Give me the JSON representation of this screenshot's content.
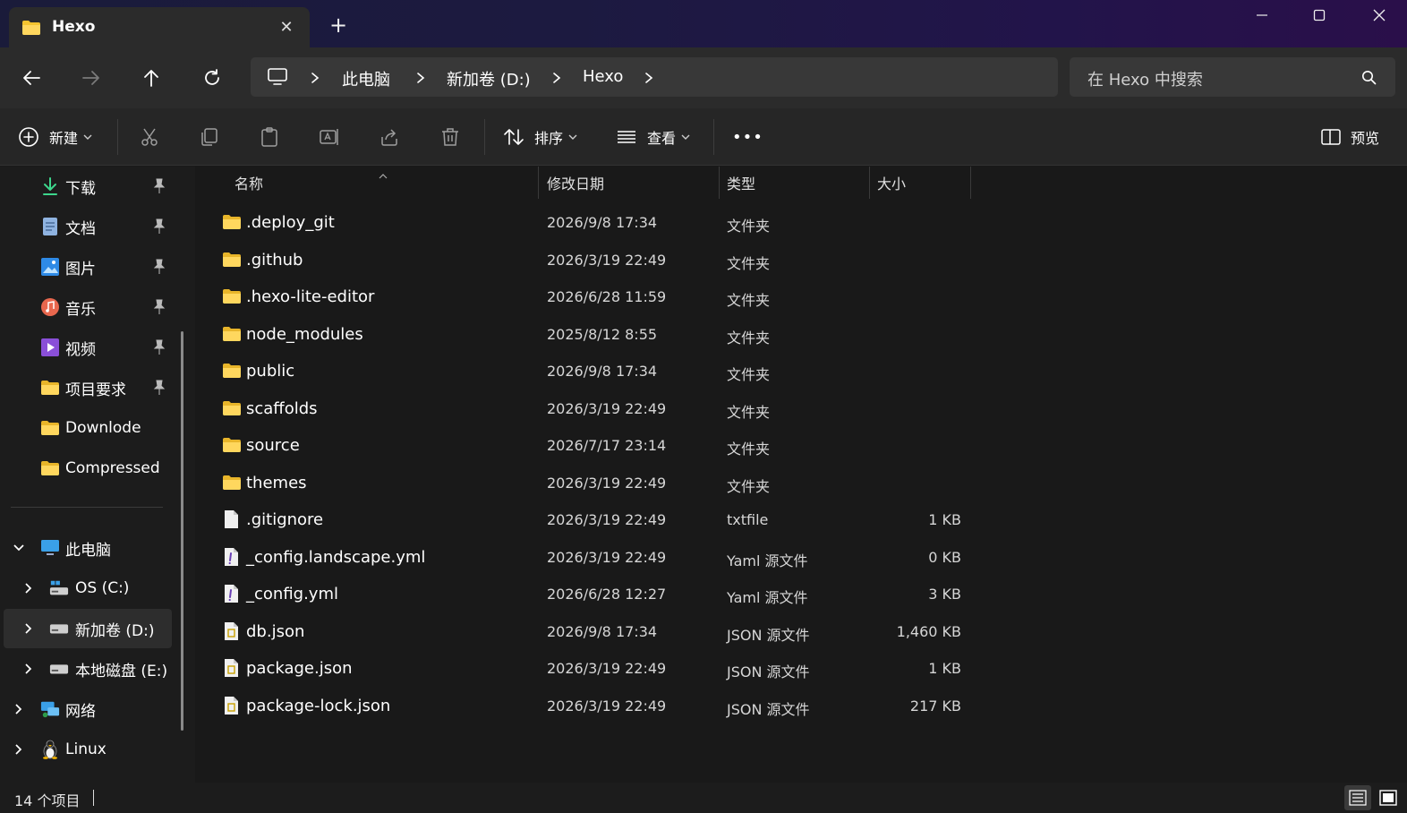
{
  "window": {
    "tab_title": "Hexo",
    "new_tab_symbol": "+",
    "close_tab_symbol": "✕"
  },
  "address": {
    "crumbs": [
      "此电脑",
      "新加卷 (D:)",
      "Hexo"
    ]
  },
  "search": {
    "placeholder": "在 Hexo 中搜索"
  },
  "toolbar": {
    "new_label": "新建",
    "sort_label": "排序",
    "view_label": "查看",
    "more_label": "•••",
    "preview_label": "预览"
  },
  "sidebar": {
    "quick_access": [
      {
        "label": "下载",
        "icon": "download-icon",
        "pinned": true
      },
      {
        "label": "文档",
        "icon": "document-icon",
        "pinned": true
      },
      {
        "label": "图片",
        "icon": "pictures-icon",
        "pinned": true
      },
      {
        "label": "音乐",
        "icon": "music-icon",
        "pinned": true
      },
      {
        "label": "视频",
        "icon": "videos-icon",
        "pinned": true
      },
      {
        "label": "项目要求",
        "icon": "folder-icon",
        "pinned": true
      },
      {
        "label": "Downlode",
        "icon": "folder-icon",
        "pinned": false
      },
      {
        "label": "Compressed",
        "icon": "folder-icon",
        "pinned": false
      }
    ],
    "this_pc": "此电脑",
    "drives": [
      {
        "label": "OS (C:)",
        "icon": "system-drive-icon"
      },
      {
        "label": "新加卷 (D:)",
        "icon": "drive-icon",
        "selected": true
      },
      {
        "label": "本地磁盘 (E:)",
        "icon": "drive-icon"
      }
    ],
    "network": "网络",
    "linux": "Linux"
  },
  "columns": {
    "name": "名称",
    "modified": "修改日期",
    "type": "类型",
    "size": "大小"
  },
  "files": [
    {
      "name": ".deploy_git",
      "modified": "2026/9/8 17:34",
      "type": "文件夹",
      "size": "",
      "kind": "folder"
    },
    {
      "name": ".github",
      "modified": "2026/3/19 22:49",
      "type": "文件夹",
      "size": "",
      "kind": "folder"
    },
    {
      "name": ".hexo-lite-editor",
      "modified": "2026/6/28 11:59",
      "type": "文件夹",
      "size": "",
      "kind": "folder"
    },
    {
      "name": "node_modules",
      "modified": "2025/8/12 8:55",
      "type": "文件夹",
      "size": "",
      "kind": "folder"
    },
    {
      "name": "public",
      "modified": "2026/9/8 17:34",
      "type": "文件夹",
      "size": "",
      "kind": "folder"
    },
    {
      "name": "scaffolds",
      "modified": "2026/3/19 22:49",
      "type": "文件夹",
      "size": "",
      "kind": "folder"
    },
    {
      "name": "source",
      "modified": "2026/7/17 23:14",
      "type": "文件夹",
      "size": "",
      "kind": "folder"
    },
    {
      "name": "themes",
      "modified": "2026/3/19 22:49",
      "type": "文件夹",
      "size": "",
      "kind": "folder"
    },
    {
      "name": ".gitignore",
      "modified": "2026/3/19 22:49",
      "type": "txtfile",
      "size": "1 KB",
      "kind": "file"
    },
    {
      "name": "_config.landscape.yml",
      "modified": "2026/3/19 22:49",
      "type": "Yaml 源文件",
      "size": "0 KB",
      "kind": "yaml"
    },
    {
      "name": "_config.yml",
      "modified": "2026/6/28 12:27",
      "type": "Yaml 源文件",
      "size": "3 KB",
      "kind": "yaml"
    },
    {
      "name": "db.json",
      "modified": "2026/9/8 17:34",
      "type": "JSON 源文件",
      "size": "1,460 KB",
      "kind": "json"
    },
    {
      "name": "package.json",
      "modified": "2026/3/19 22:49",
      "type": "JSON 源文件",
      "size": "1 KB",
      "kind": "json"
    },
    {
      "name": "package-lock.json",
      "modified": "2026/3/19 22:49",
      "type": "JSON 源文件",
      "size": "217 KB",
      "kind": "json"
    }
  ],
  "status": {
    "item_count": "14 个项目"
  },
  "colors": {
    "folder": "#f4c430",
    "accent": "#4cc2ff",
    "background": "#191919"
  }
}
